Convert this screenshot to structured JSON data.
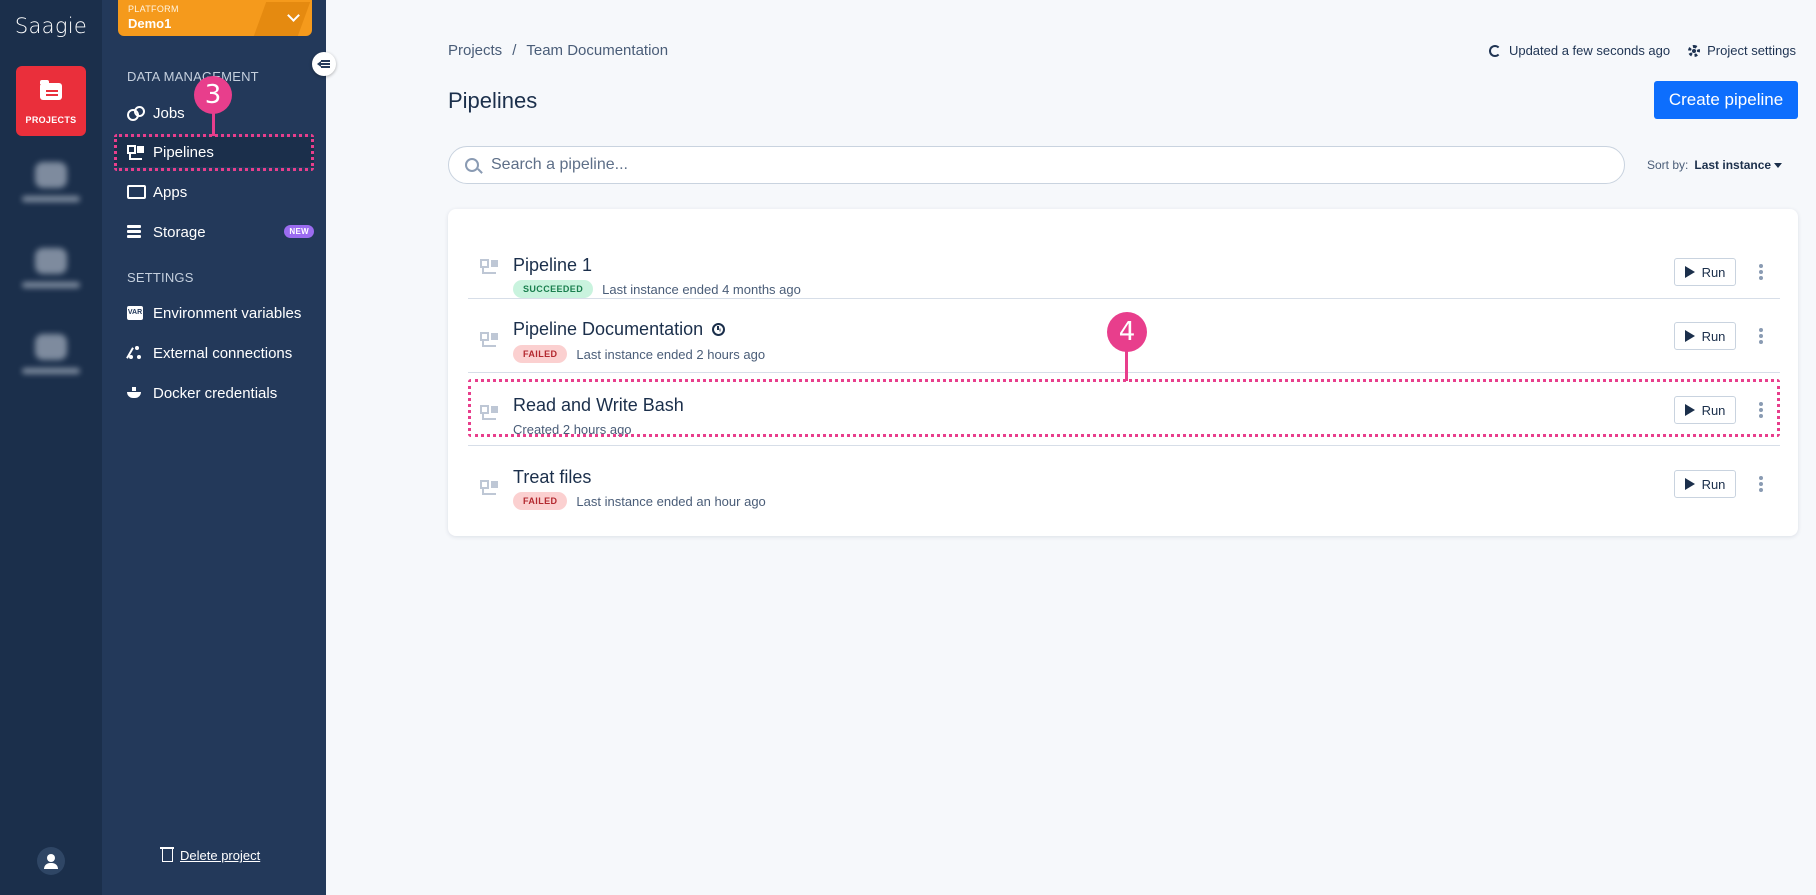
{
  "rail": {
    "logo": "Saagie",
    "projects_label": "PROJECTS"
  },
  "platform": {
    "label": "PLATFORM",
    "name": "Demo1"
  },
  "sidebar": {
    "data_management_title": "DATA MANAGEMENT",
    "settings_title": "SETTINGS",
    "items": [
      {
        "label": "Jobs",
        "icon": "jobs-icon"
      },
      {
        "label": "Pipelines",
        "icon": "pipeline-icon"
      },
      {
        "label": "Apps",
        "icon": "apps-icon"
      },
      {
        "label": "Storage",
        "icon": "storage-icon",
        "badge": "NEW"
      }
    ],
    "settings_items": [
      {
        "label": "Environment variables",
        "icon": "var-icon",
        "icon_text": "VAR"
      },
      {
        "label": "External connections",
        "icon": "external-connections-icon"
      },
      {
        "label": "Docker credentials",
        "icon": "docker-icon"
      }
    ],
    "delete_label": "Delete project"
  },
  "annotations": {
    "step3": "3",
    "step4": "4",
    "color": "#e83e8c"
  },
  "header": {
    "breadcrumb": [
      "Projects",
      "Team Documentation"
    ],
    "breadcrumb_sep": "/",
    "updated": "Updated a few seconds ago",
    "settings": "Project settings",
    "title": "Pipelines",
    "create_button": "Create pipeline"
  },
  "search": {
    "placeholder": "Search a pipeline..."
  },
  "sort": {
    "label": "Sort by:",
    "value": "Last instance"
  },
  "pipelines": [
    {
      "name": "Pipeline 1",
      "status": "SUCCEEDED",
      "meta": "Last instance ended 4 months ago",
      "run": "Run"
    },
    {
      "name": "Pipeline Documentation",
      "status": "FAILED",
      "meta": "Last instance ended 2 hours ago",
      "run": "Run",
      "scheduled": true
    },
    {
      "name": "Read and Write Bash",
      "status": "",
      "meta": "Created 2 hours ago",
      "run": "Run"
    },
    {
      "name": "Treat files",
      "status": "FAILED",
      "meta": "Last instance ended an hour ago",
      "run": "Run"
    }
  ],
  "colors": {
    "rail": "#1b2f4b",
    "sidebar": "#23395a",
    "accent": "#0d6efd",
    "projects": "#ea2f3b",
    "platform": "#f59a1c",
    "succeeded": "#c9f3de",
    "failed": "#fbd0d0"
  }
}
